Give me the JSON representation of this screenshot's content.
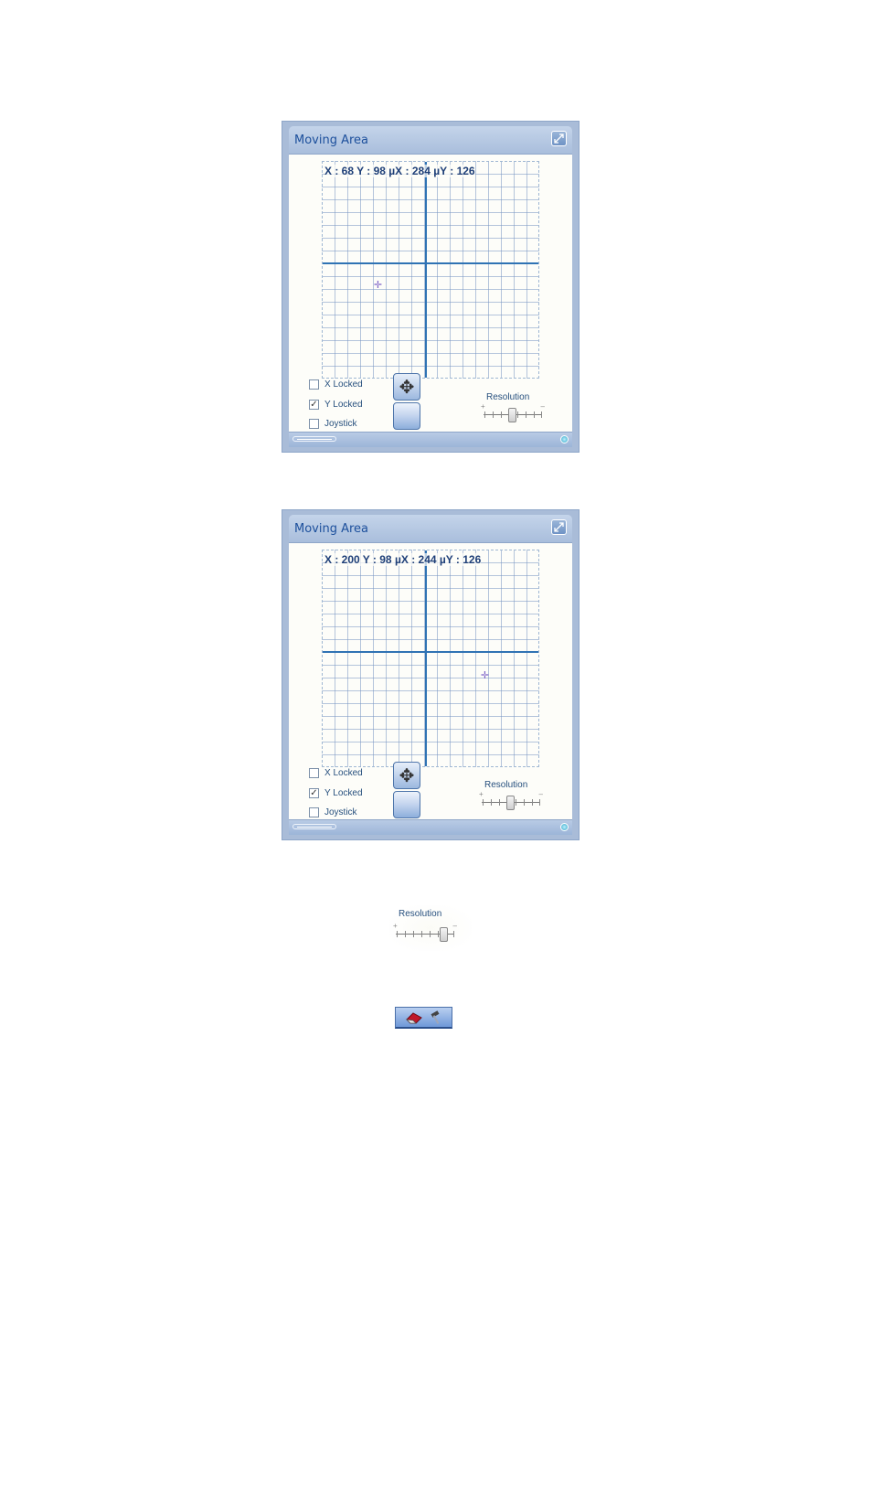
{
  "panels": [
    {
      "title": "Moving Area",
      "coords": "X : 68 Y : 98 µX : 284 µY : 126",
      "checkboxes": [
        {
          "label": "X Locked",
          "checked": false
        },
        {
          "label": "Y Locked",
          "checked": true
        },
        {
          "label": "Joystick",
          "checked": false
        }
      ],
      "resolution_label": "Resolution"
    },
    {
      "title": "Moving Area",
      "coords": "X : 200 Y : 98 µX : 244 µY : 126",
      "checkboxes": [
        {
          "label": "X Locked",
          "checked": false
        },
        {
          "label": "Y Locked",
          "checked": true
        },
        {
          "label": "Joystick",
          "checked": false
        }
      ],
      "resolution_label": "Resolution"
    }
  ],
  "standalone_resolution": {
    "label": "Resolution"
  },
  "toolbar_button": {
    "icons": [
      "eraser-icon",
      "hammer-icon"
    ]
  },
  "colors": {
    "accent": "#2f73b4",
    "title": "#1c4f9c",
    "panel_frame": "#a9bcd8"
  }
}
